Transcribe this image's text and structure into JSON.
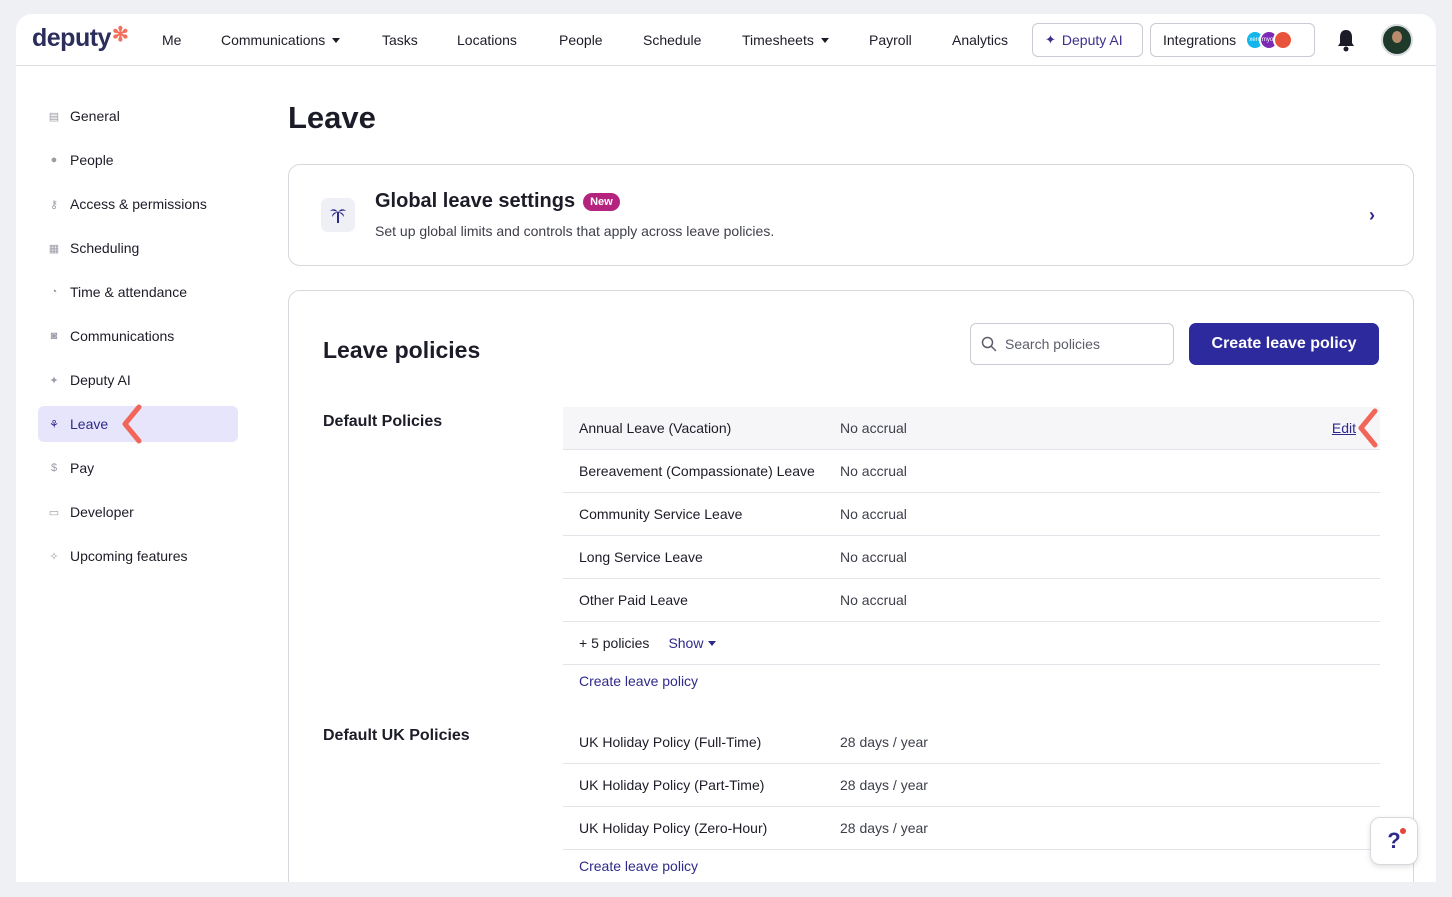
{
  "nav": {
    "logo": "deputy",
    "items": [
      "Me",
      "Communications",
      "Tasks",
      "Locations",
      "People",
      "Schedule",
      "Timesheets",
      "Payroll",
      "Analytics"
    ],
    "ai_label": "Deputy AI",
    "integrations_label": "Integrations",
    "integration_logos": [
      "xero",
      "myob",
      ""
    ]
  },
  "sidebar": {
    "items": [
      {
        "label": "General",
        "icon": "store-icon"
      },
      {
        "label": "People",
        "icon": "person-icon"
      },
      {
        "label": "Access & permissions",
        "icon": "key-icon"
      },
      {
        "label": "Scheduling",
        "icon": "calendar-icon"
      },
      {
        "label": "Time & attendance",
        "icon": "clock-icon"
      },
      {
        "label": "Communications",
        "icon": "chat-icon"
      },
      {
        "label": "Deputy AI",
        "icon": "sparkle-icon"
      },
      {
        "label": "Leave",
        "icon": "palm-tree-icon"
      },
      {
        "label": "Pay",
        "icon": "dollar-icon"
      },
      {
        "label": "Developer",
        "icon": "monitor-icon"
      },
      {
        "label": "Upcoming features",
        "icon": "sparkles-icon"
      }
    ],
    "active": "Leave"
  },
  "page": {
    "title": "Leave"
  },
  "global_settings": {
    "title": "Global leave settings",
    "badge": "New",
    "subtitle": "Set up global limits and controls that apply across leave policies."
  },
  "leave_policies": {
    "title": "Leave policies",
    "search_placeholder": "Search policies",
    "create_button": "Create leave policy",
    "groups": [
      {
        "title": "Default Policies",
        "rows": [
          {
            "name": "Annual Leave (Vacation)",
            "value": "No accrual",
            "action": "Edit"
          },
          {
            "name": "Bereavement (Compassionate) Leave",
            "value": "No accrual"
          },
          {
            "name": "Community Service Leave",
            "value": "No accrual"
          },
          {
            "name": "Long Service Leave",
            "value": "No accrual"
          },
          {
            "name": "Other Paid Leave",
            "value": "No accrual"
          }
        ],
        "more_label": "+ 5 policies",
        "show_label": "Show",
        "create_link": "Create leave policy"
      },
      {
        "title": "Default UK Policies",
        "rows": [
          {
            "name": "UK Holiday Policy (Full-Time)",
            "value": "28 days / year"
          },
          {
            "name": "UK Holiday Policy (Part-Time)",
            "value": "28 days / year"
          },
          {
            "name": "UK Holiday Policy (Zero-Hour)",
            "value": "28 days / year"
          }
        ],
        "create_link": "Create leave policy"
      }
    ]
  },
  "help": {
    "label": "?"
  },
  "colors": {
    "accent": "#2c2a9c",
    "badge": "#b4247f",
    "pointer": "#f2665a",
    "active_bg": "#e7e5fb"
  }
}
